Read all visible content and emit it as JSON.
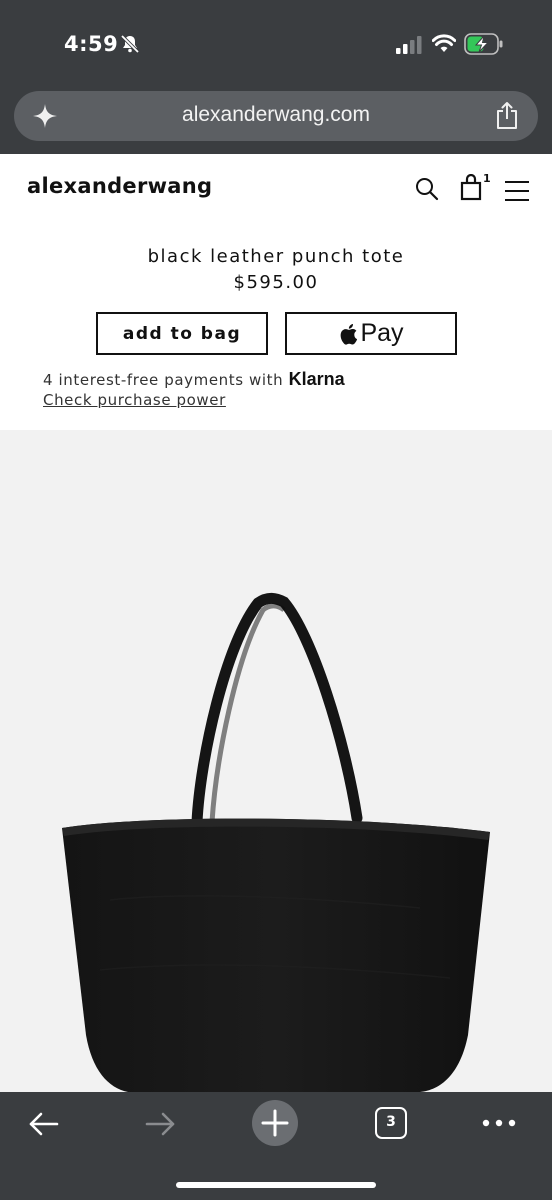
{
  "status_bar": {
    "time": "4:59",
    "icons": [
      "bell-slash-icon",
      "cellular-signal-icon",
      "wifi-icon",
      "battery-charging-icon"
    ]
  },
  "browser": {
    "url": "alexanderwang.com",
    "tab_count": "3",
    "icons": [
      "sparkle-icon",
      "share-icon",
      "back-arrow-icon",
      "forward-arrow-icon",
      "plus-icon",
      "tabs-icon",
      "more-icon"
    ]
  },
  "site": {
    "logo": "alexanderwang",
    "bag_count": "1"
  },
  "product": {
    "title": "black leather punch tote",
    "price": "$595.00",
    "add_to_bag_label": "add to bag",
    "apple_pay_label": "Pay",
    "klarna_text": "4 interest-free payments with ",
    "klarna_brand": "Klarna",
    "klarna_link": "Check purchase power"
  },
  "colors": {
    "chrome": "#3a3d40",
    "url_bar": "#5c5f63",
    "battery_green": "#34c759",
    "image_bg": "#f2f2f2"
  }
}
